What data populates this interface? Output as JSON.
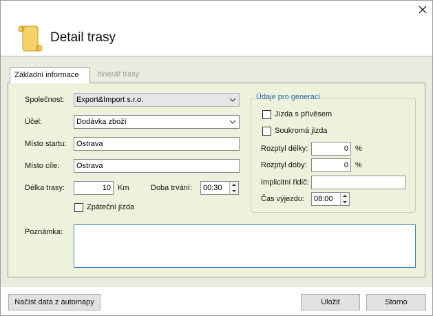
{
  "window": {
    "title": "Detail trasy"
  },
  "tabs": [
    {
      "label": "Základní informace"
    },
    {
      "label": "Itinerář trasy"
    }
  ],
  "form": {
    "company_label": "Společnost:",
    "company_value": "Export&Import s.r.o.",
    "purpose_label": "Účel:",
    "purpose_value": "Dodávka zboží",
    "start_label": "Místo startu:",
    "start_value": "Ostrava",
    "dest_label": "Místo cíle:",
    "dest_value": "Ostrava",
    "length_label": "Délka trasy:",
    "length_value": "10",
    "length_unit": "Km",
    "duration_label": "Doba trvání:",
    "duration_value": "00:30",
    "return_label": "Zpáteční jízda",
    "note_label": "Poznámka:",
    "note_value": ""
  },
  "generation": {
    "title": "Údaje pro generaci",
    "trailer_label": "Jízda s přívěsem",
    "private_label": "Soukromá jízda",
    "length_spread_label": "Rozptyl délky:",
    "length_spread_value": "0",
    "length_spread_unit": "%",
    "time_spread_label": "Rozptyl doby:",
    "time_spread_value": "0",
    "time_spread_unit": "%",
    "driver_label": "Implicitní řidič:",
    "driver_value": "",
    "departure_label": "Čas výjezdu:",
    "departure_value": "08:00"
  },
  "buttons": {
    "load": "Načíst data z automapy",
    "save": "Uložit",
    "cancel": "Storno"
  },
  "colors": {
    "panel_bg": "#eef1db",
    "group_title": "#2b5fab",
    "note_border": "#3b84c5"
  }
}
